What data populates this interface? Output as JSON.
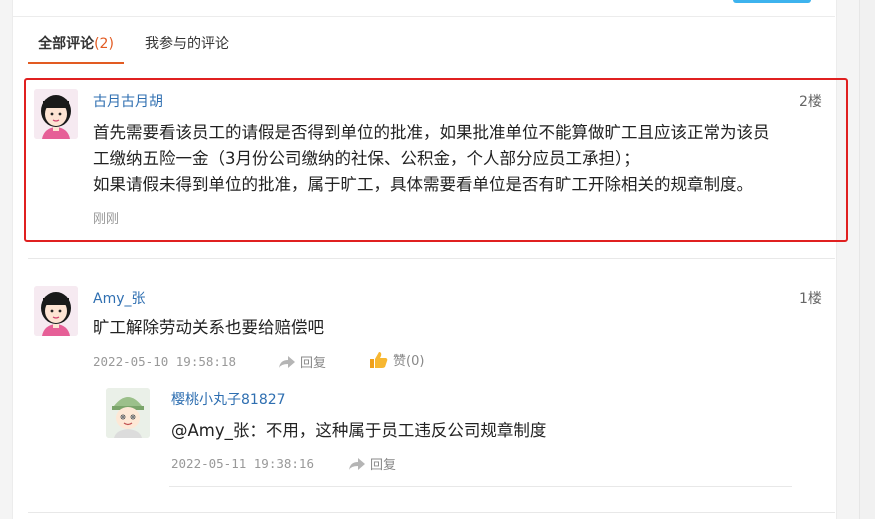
{
  "tabs": {
    "all_label": "全部评论",
    "all_count": "(2)",
    "mine_label": "我参与的评论"
  },
  "comments": [
    {
      "user": "古月古月胡",
      "floor": "2楼",
      "lines": [
        "首先需要看该员工的请假是否得到单位的批准，如果批准单位不能算做旷工且应该正常为该员",
        "工缴纳五险一金（3月份公司缴纳的社保、公积金，个人部分应员工承担）；",
        "如果请假未得到单位的批准，属于旷工，具体需要看单位是否有旷工开除相关的规章制度。"
      ],
      "time": "刚刚"
    },
    {
      "user": "Amy_张",
      "floor": "1楼",
      "text": "旷工解除劳动关系也要给赔偿吧",
      "time": "2022-05-10 19:58:18",
      "reply_label": "回复",
      "like_label": "赞(0)",
      "reply": {
        "user": "樱桃小丸子81827",
        "text": "@Amy_张：不用，这种属于员工违反公司规章制度",
        "time": "2022-05-11 19:38:16",
        "reply_label": "回复"
      }
    }
  ],
  "colors": {
    "accent": "#e25b22",
    "link": "#2f6fb1",
    "highlight": "#e02020"
  }
}
